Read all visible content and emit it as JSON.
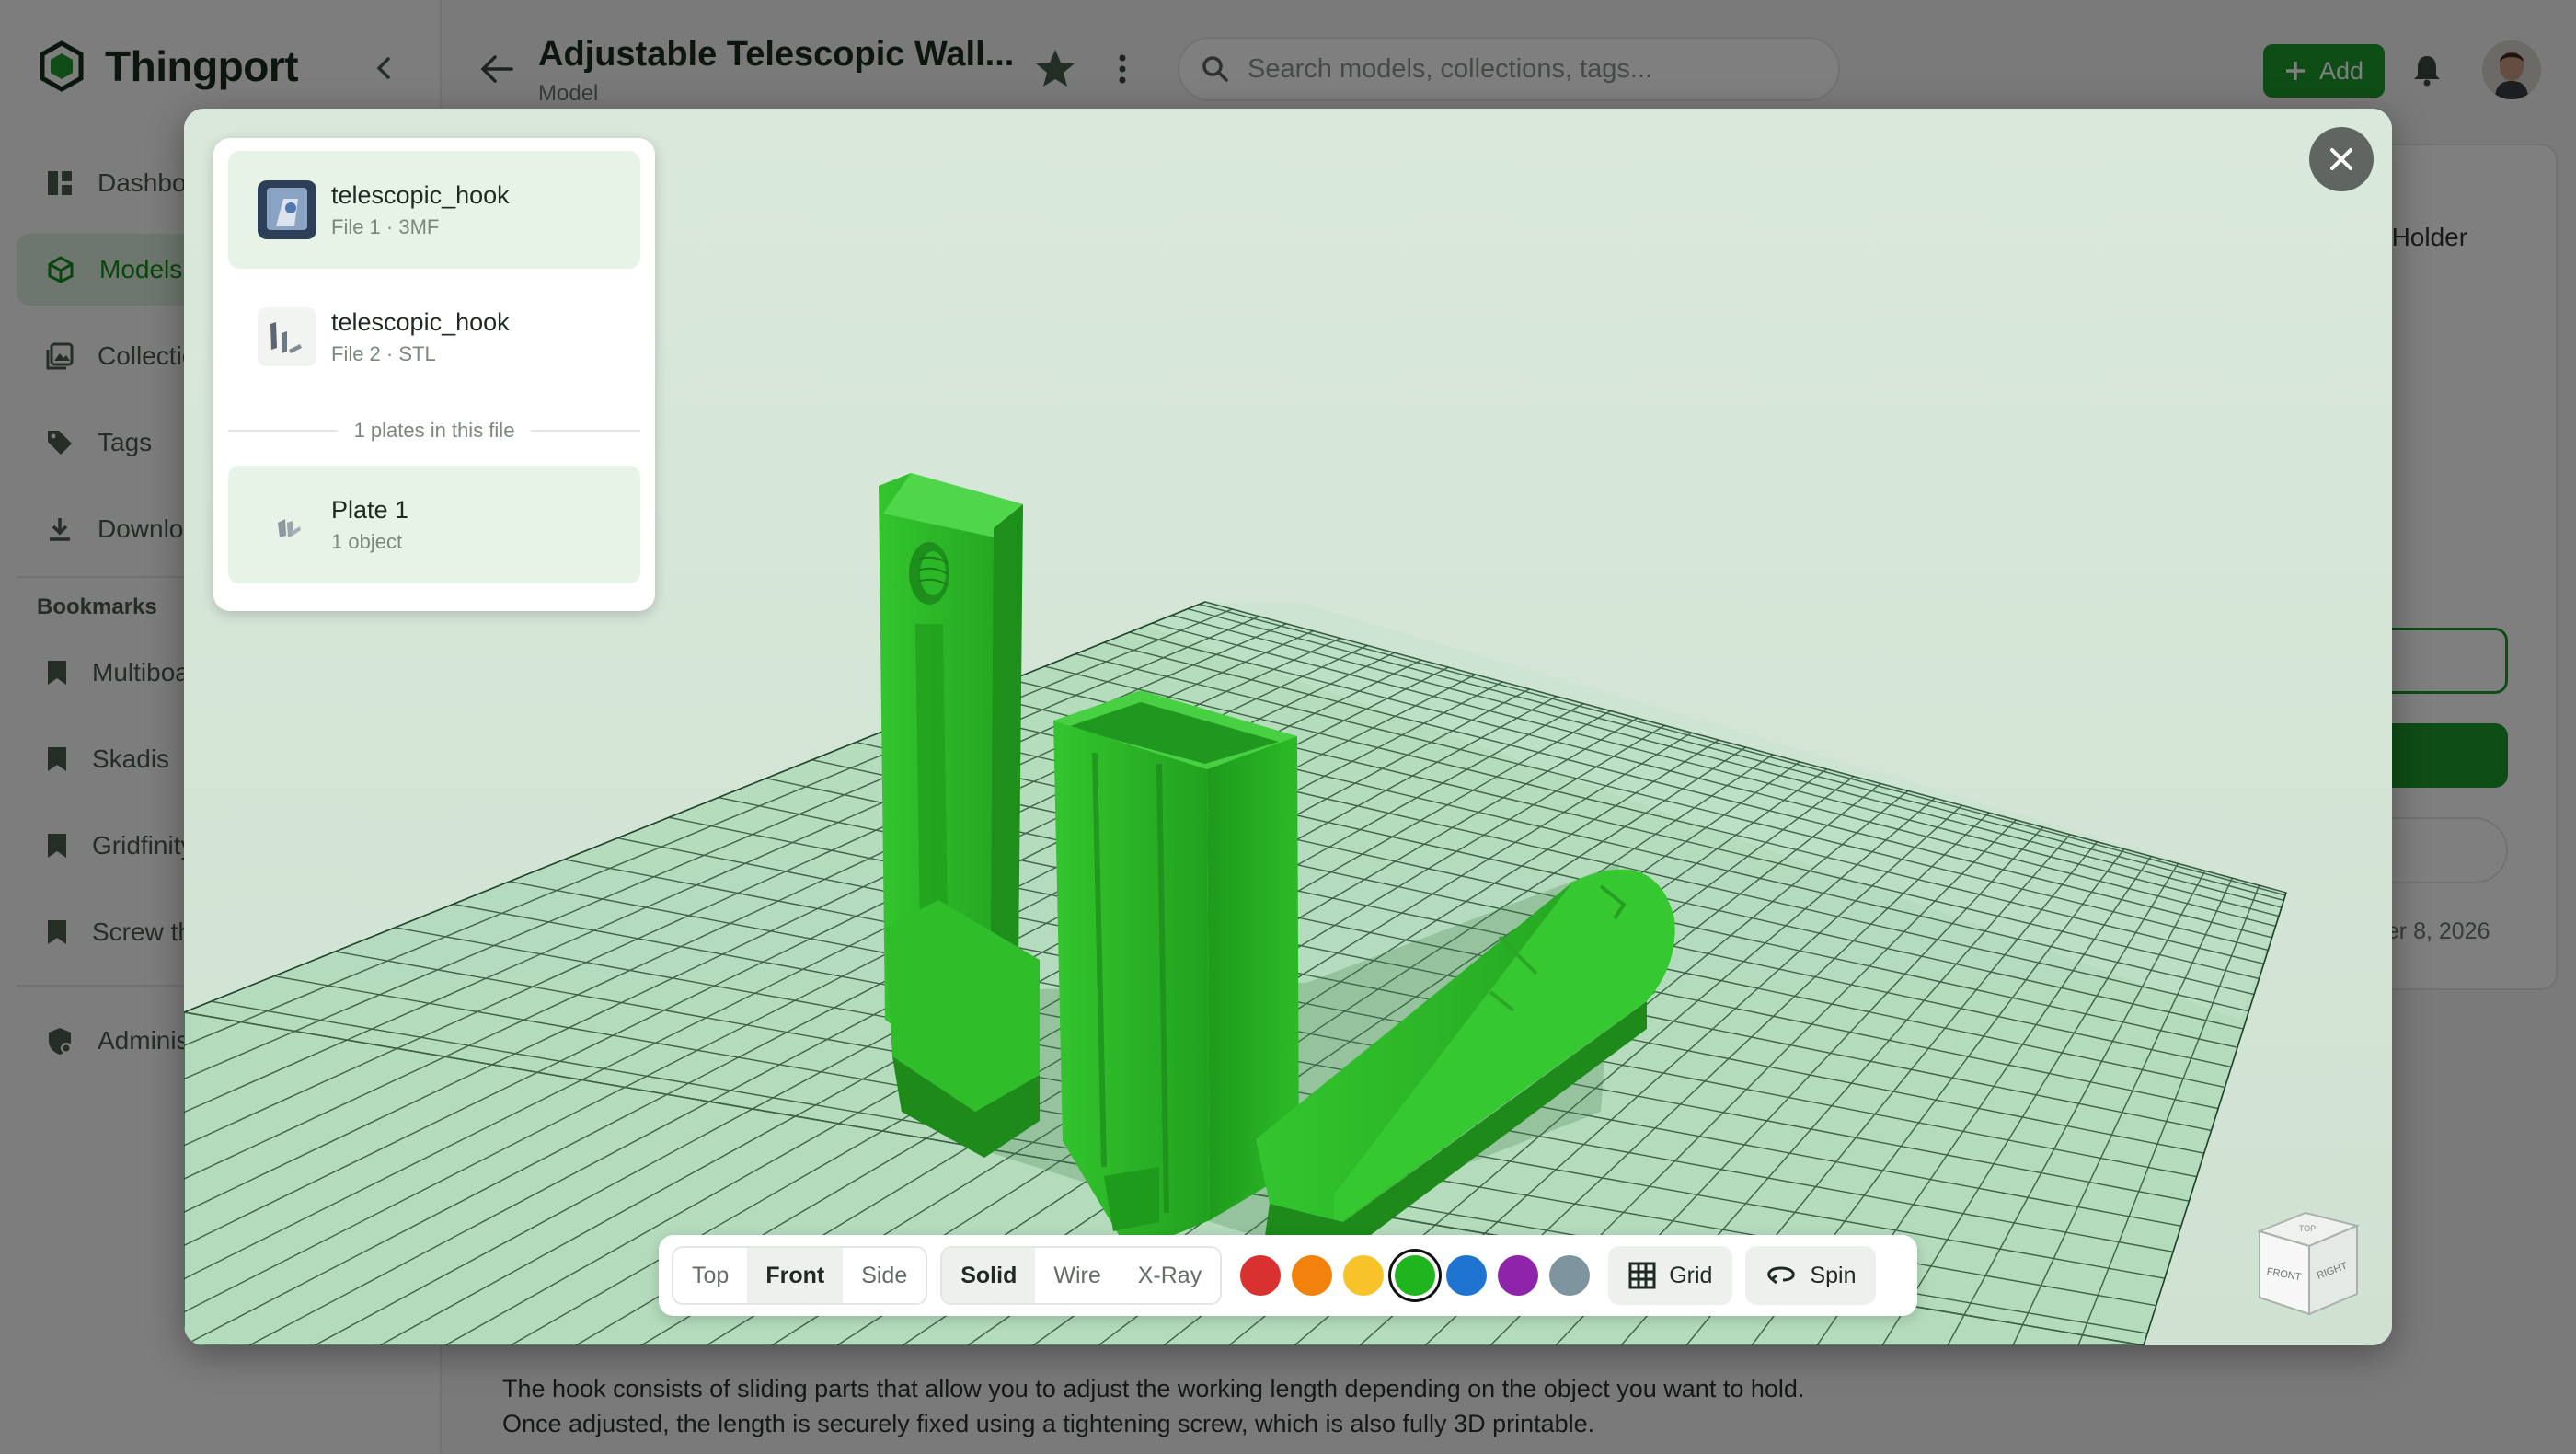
{
  "app": {
    "name": "Thingport",
    "brand_color": "#1c9a2a"
  },
  "sidebar": {
    "items": [
      {
        "label": "Dashboard",
        "icon": "dashboard-icon",
        "active": false
      },
      {
        "label": "Models",
        "icon": "cube-icon",
        "active": true
      },
      {
        "label": "Collections",
        "icon": "collections-icon",
        "active": false
      },
      {
        "label": "Tags",
        "icon": "tag-icon",
        "active": false
      },
      {
        "label": "Downloads",
        "icon": "download-icon",
        "active": false
      }
    ],
    "bookmarks_title": "Bookmarks",
    "bookmarks": [
      {
        "label": "Multiboard"
      },
      {
        "label": "Skadis"
      },
      {
        "label": "Gridfinity"
      },
      {
        "label": "Screw thread"
      }
    ],
    "admin_label": "Administration"
  },
  "header": {
    "title": "Adjustable Telescopic Wall...",
    "subtitle": "Model",
    "search_placeholder": "Search models, collections, tags...",
    "add_label": "Add"
  },
  "right_card": {
    "holder_text": "le Holder",
    "date_text": "ber 8, 2026"
  },
  "description": "The hook consists of sliding parts that allow you to adjust the working length depending on the object you want to hold. Once adjusted, the length is securely fixed using a tightening screw, which is also fully 3D printable.",
  "viewer": {
    "files": [
      {
        "name": "telescopic_hook",
        "meta": "File 1 · 3MF",
        "selected": true
      },
      {
        "name": "telescopic_hook",
        "meta": "File 2 · STL",
        "selected": false
      }
    ],
    "plates_label": "1 plates in this file",
    "plates": [
      {
        "name": "Plate 1",
        "meta": "1 object",
        "selected": true
      }
    ],
    "views": [
      {
        "label": "Top",
        "active": false
      },
      {
        "label": "Front",
        "active": true
      },
      {
        "label": "Side",
        "active": false
      }
    ],
    "render_modes": [
      {
        "label": "Solid",
        "active": true
      },
      {
        "label": "Wire",
        "active": false
      },
      {
        "label": "X-Ray",
        "active": false
      }
    ],
    "colors": [
      {
        "hex": "#d93030",
        "selected": false
      },
      {
        "hex": "#f2820c",
        "selected": false
      },
      {
        "hex": "#f7c22a",
        "selected": false
      },
      {
        "hex": "#1fb51f",
        "selected": true
      },
      {
        "hex": "#1f74d1",
        "selected": false
      },
      {
        "hex": "#8e24aa",
        "selected": false
      },
      {
        "hex": "#7e95a0",
        "selected": false
      }
    ],
    "grid_label": "Grid",
    "spin_label": "Spin",
    "cube_labels": {
      "front": "FRONT",
      "right": "RIGHT",
      "top": "TOP"
    }
  }
}
